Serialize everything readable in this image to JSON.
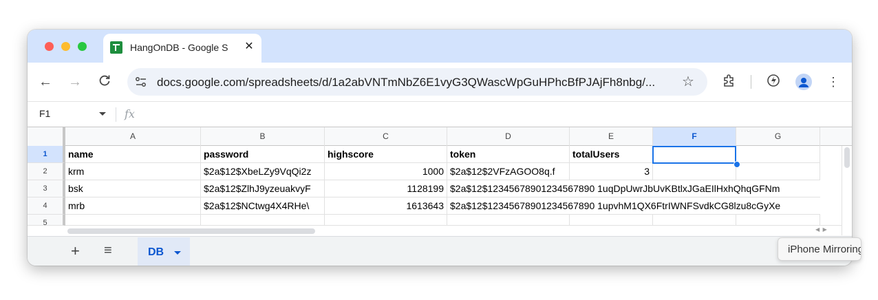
{
  "browser": {
    "tab_title": "HangOnDB - Google S",
    "url": "docs.google.com/spreadsheets/d/1a2abVNTmNbZ6E1vyG3QWascWpGuHPhcBfPJAjFh8nbg/..."
  },
  "formula_bar": {
    "name_box": "F1",
    "fx": "fx"
  },
  "sheet": {
    "columns": [
      "A",
      "B",
      "C",
      "D",
      "E",
      "F",
      "G"
    ],
    "selected_column": "F",
    "row_numbers": [
      "1",
      "2",
      "3",
      "4",
      "5"
    ],
    "rows": [
      [
        "name",
        "password",
        "highscore",
        "token",
        "totalUsers",
        "",
        ""
      ],
      [
        "krm",
        "$2a$12$XbeLZy9VqQi2z",
        "1000",
        "$2a$12$2VFzAGOO8q.f",
        "3",
        "",
        ""
      ],
      [
        "bsk",
        "$2a$12$ZlhJ9yzeuakvyF",
        "1128199",
        "$2a$12$1234567890123456789 01uqDpUwrJbUvKBtlxJGaEIlHxhQhqGFNm",
        "",
        "",
        ""
      ],
      [
        "mrb",
        "$2a$12$NCtwg4X4RHe\\",
        "1613643",
        "$2a$12$1234567890123456789 01upvhM1QX6FtrIWNFSvdkCG8lzu8cGyXe",
        "",
        "",
        ""
      ]
    ],
    "cells": {
      "a1": "name",
      "b1": "password",
      "c1": "highscore",
      "d1": "token",
      "e1": "totalUsers",
      "a2": "krm",
      "b2": "$2a$12$XbeLZy9VqQi2z",
      "c2": "1000",
      "d2": "$2a$12$2VFzAGOO8q.f",
      "e2": "3",
      "a3": "bsk",
      "b3": "$2a$12$ZlhJ9yzeuakvyF",
      "c3": "1128199",
      "d3": "$2a$12$12345678901234567890 1uqDpUwrJbUvKBtlxJGaEIlHxhQhqGFNm",
      "a4": "mrb",
      "b4": "$2a$12$NCtwg4X4RHe\\",
      "c4": "1613643",
      "d4": "$2a$12$12345678901234567890 1upvhM1QX6FtrIWNFSvdkCG8lzu8cGyXe"
    }
  },
  "sheet_tabs": {
    "add": "+",
    "all_sheets": "≡",
    "active": "DB"
  },
  "tooltip": "iPhone Mirroring",
  "colors": {
    "accent": "#0b57d0",
    "tab_strip": "#d3e3fd",
    "selection": "#1a73e8"
  }
}
